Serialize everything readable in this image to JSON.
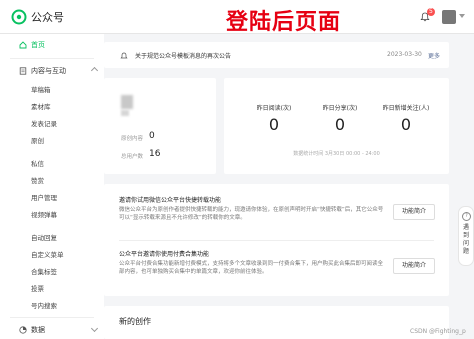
{
  "app": {
    "title": "公众号",
    "logo_icon": "wechat-mp-logo-icon",
    "brand_color": "#07c160"
  },
  "banner": "登陆后页面",
  "header": {
    "notification_badge": "5",
    "notification_icon": "bell-icon"
  },
  "sidebar": {
    "home": "首页",
    "content_group": "内容与互动",
    "content_items": [
      "草稿箱",
      "素材库",
      "发表记录",
      "原创"
    ],
    "interact_items": [
      "私信",
      "赞赏",
      "用户管理",
      "视频弹幕"
    ],
    "reply_items": [
      "自动回复",
      "自定义菜单",
      "合集标签",
      "投票",
      "号内搜索"
    ],
    "data_group": "数据"
  },
  "notice": {
    "text": "关于规范公众号模板消息的再次公告",
    "date": "2023-03-30",
    "more": "更多"
  },
  "account": {
    "original_label": "原创内容",
    "original_value": "0",
    "users_label": "总用户数",
    "users_value": "16"
  },
  "stats": {
    "items": [
      {
        "label": "昨日阅读(次)",
        "value": "0"
      },
      {
        "label": "昨日分享(次)",
        "value": "0"
      },
      {
        "label": "昨日新增关注(人)",
        "value": "0"
      }
    ],
    "footer": "数据统计时间 3月30日 00:00 - 24:00"
  },
  "tasks": [
    {
      "title": "邀请你试用微信公众平台快捷转载功能",
      "desc": "微信公众平台为原创作者提供快捷转载的能力，现邀请你体验，在原创声明时开启“快捷转载”后，其它公众号可以“显示转载来源且不允许修改”的转载你的文章。",
      "button": "功能简介"
    },
    {
      "title": "公众平台邀请你使用付费合集功能",
      "desc": "公众平台付费合集功能新增付费模式，支持将多个文章收录到同一付费合集下，用户购买此合集后即可阅读全部内容，也可单独购买合集中的单篇文章，欢迎你前往体验。",
      "button": "功能简介"
    }
  ],
  "create": {
    "title": "新的创作"
  },
  "float_help": {
    "label": "遇到问题"
  },
  "watermark": "CSDN @Fighting_p"
}
